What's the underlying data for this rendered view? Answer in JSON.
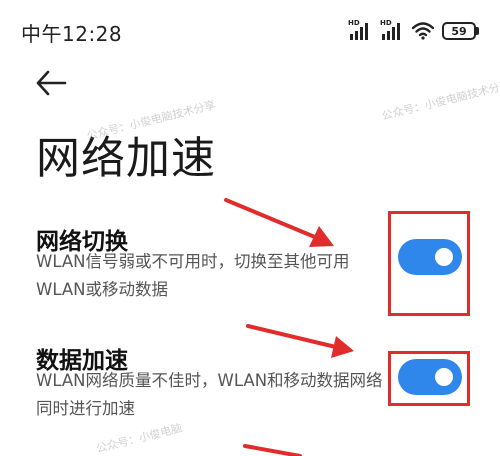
{
  "status_bar": {
    "time": "中午12:28",
    "signal_badge_1": "HD",
    "signal_badge_2": "HD",
    "battery": "59"
  },
  "header": {
    "back_icon": "arrow-left-icon",
    "title": "网络加速"
  },
  "settings": [
    {
      "title": "网络切换",
      "description": "WLAN信号弱或不可用时，切换至其他可用WLAN或移动数据",
      "enabled": true
    },
    {
      "title": "数据加速",
      "description": "WLAN网络质量不佳时，WLAN和移动数据网络同时进行加速",
      "enabled": true
    }
  ],
  "watermark": {
    "text_1": "公众号：小俊电脑技术分享",
    "text_2": "公众号：小俊电脑技术分享",
    "text_3": "公众号：小俊电脑"
  },
  "colors": {
    "toggle_on": "#2f87ec",
    "annotation_red": "#e12c2c"
  }
}
